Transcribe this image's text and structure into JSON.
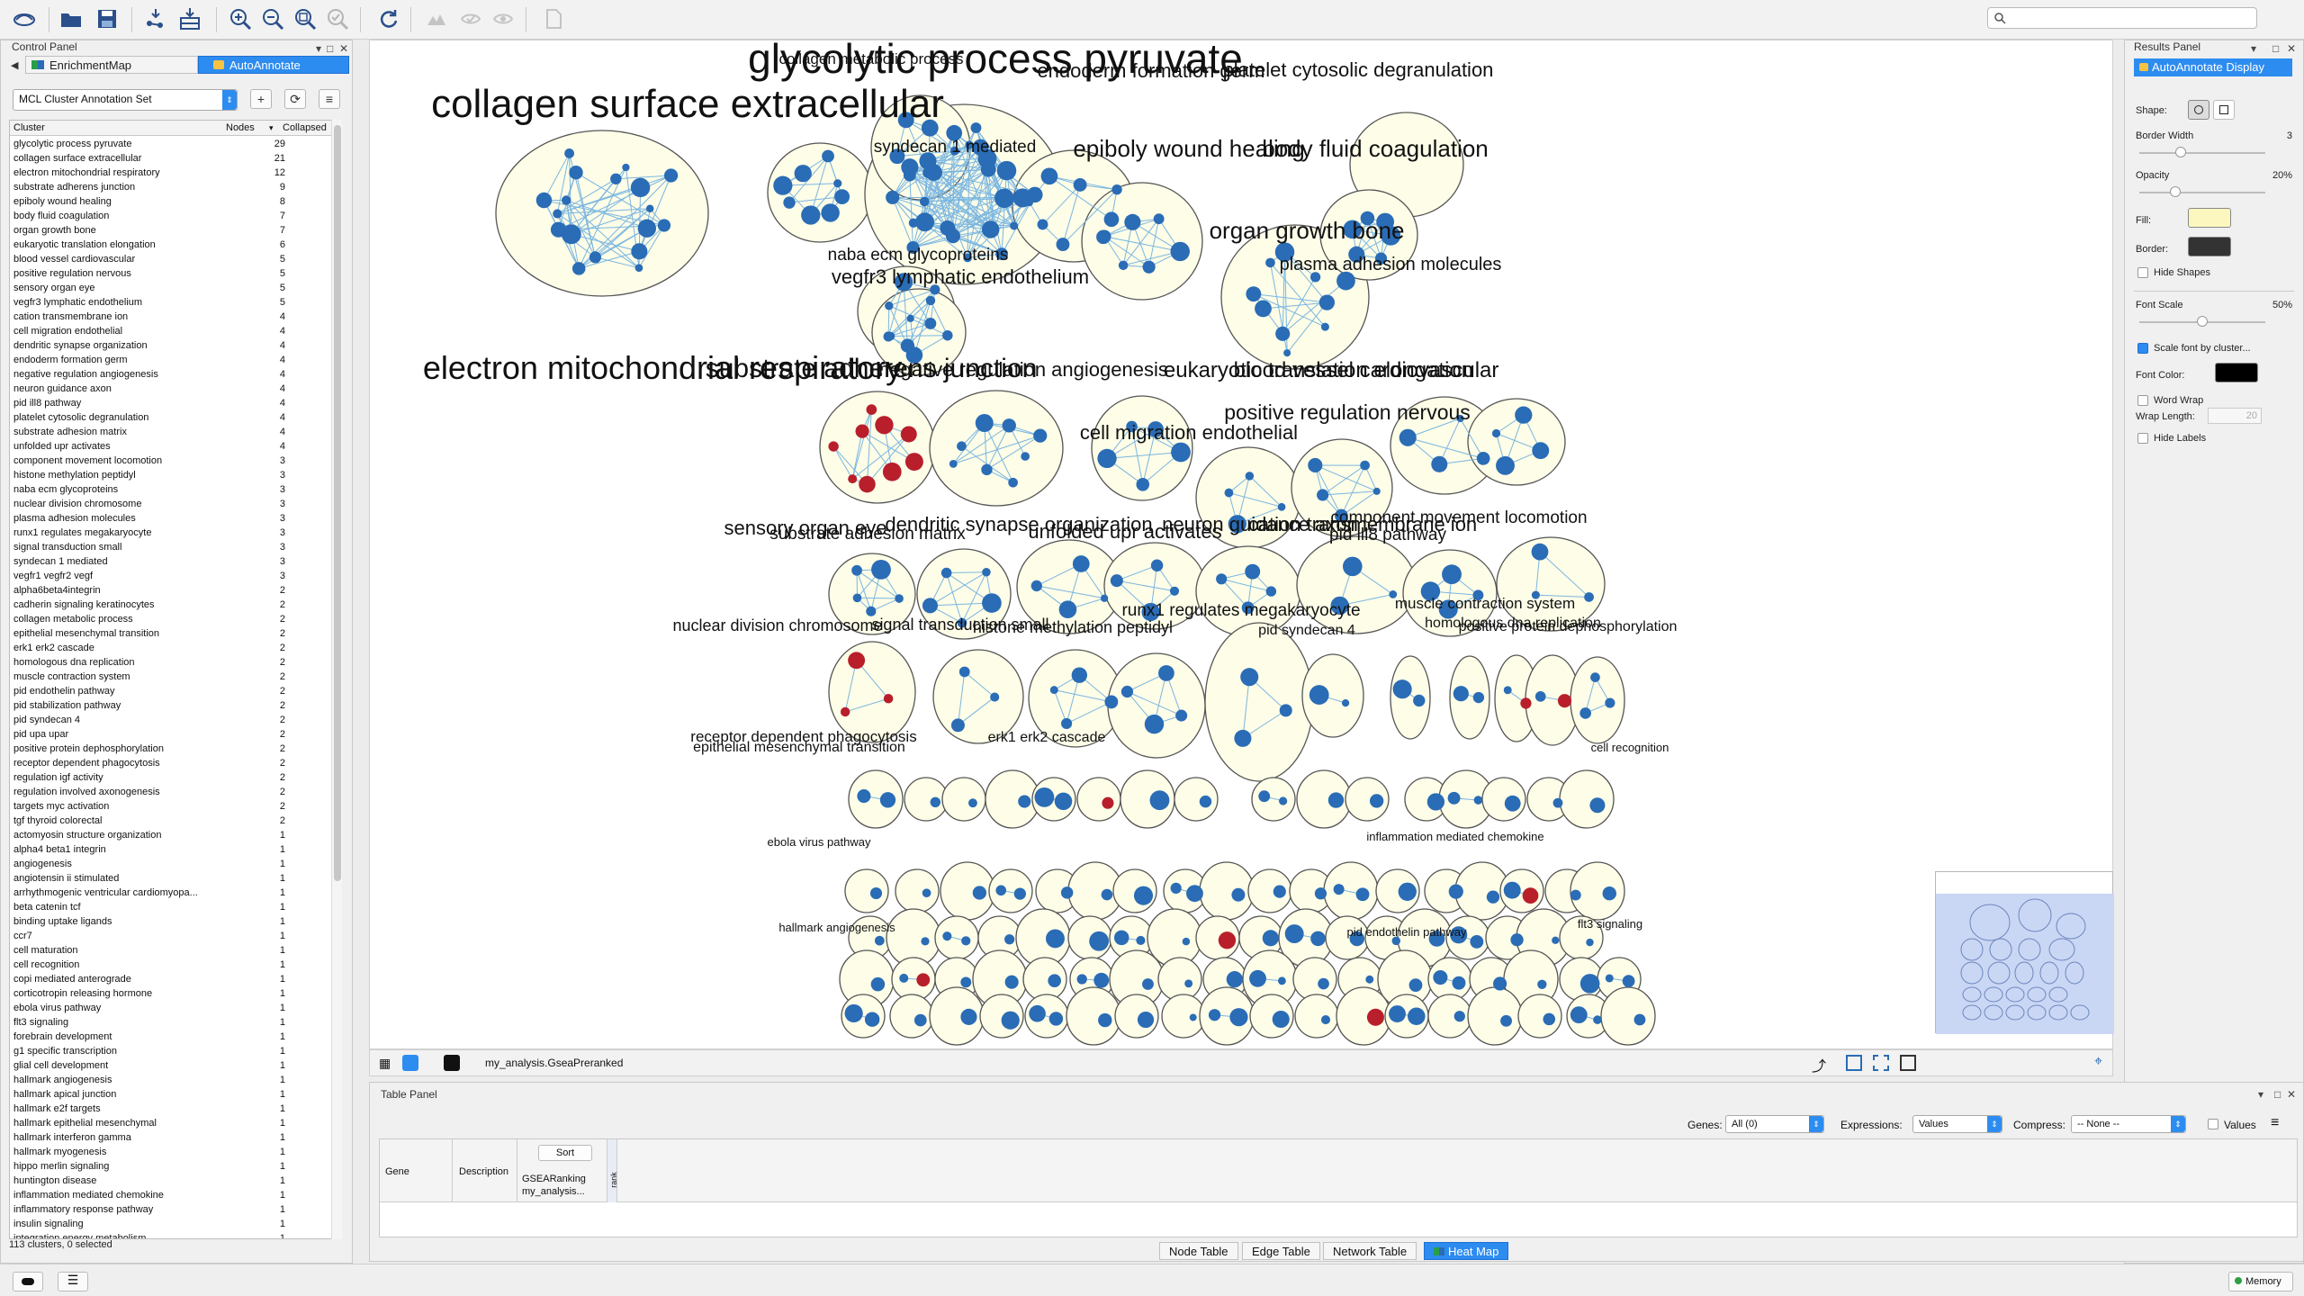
{
  "control_panel": {
    "title": "Control Panel",
    "tabs": [
      {
        "label": "EnrichmentMap"
      },
      {
        "label": "AutoAnnotate"
      }
    ],
    "annotation_set": "MCL Cluster Annotation Set",
    "columns": {
      "cluster": "Cluster",
      "nodes": "Nodes",
      "collapsed": "Collapsed"
    },
    "clusters": [
      {
        "name": "glycolytic process pyruvate",
        "nodes": "29"
      },
      {
        "name": "collagen surface extracellular",
        "nodes": "21"
      },
      {
        "name": "electron mitochondrial respiratory",
        "nodes": "12"
      },
      {
        "name": "substrate adherens junction",
        "nodes": "9"
      },
      {
        "name": "epiboly wound healing",
        "nodes": "8"
      },
      {
        "name": "body fluid coagulation",
        "nodes": "7"
      },
      {
        "name": "organ growth bone",
        "nodes": "7"
      },
      {
        "name": "eukaryotic translation elongation",
        "nodes": "6"
      },
      {
        "name": "blood vessel cardiovascular",
        "nodes": "5"
      },
      {
        "name": "positive regulation nervous",
        "nodes": "5"
      },
      {
        "name": "sensory organ eye",
        "nodes": "5"
      },
      {
        "name": "vegfr3 lymphatic endothelium",
        "nodes": "5"
      },
      {
        "name": "cation transmembrane ion",
        "nodes": "4"
      },
      {
        "name": "cell migration endothelial",
        "nodes": "4"
      },
      {
        "name": "dendritic synapse organization",
        "nodes": "4"
      },
      {
        "name": "endoderm formation germ",
        "nodes": "4"
      },
      {
        "name": "negative regulation angiogenesis",
        "nodes": "4"
      },
      {
        "name": "neuron guidance axon",
        "nodes": "4"
      },
      {
        "name": "pid ill8 pathway",
        "nodes": "4"
      },
      {
        "name": "platelet cytosolic degranulation",
        "nodes": "4"
      },
      {
        "name": "substrate adhesion matrix",
        "nodes": "4"
      },
      {
        "name": "unfolded upr activates",
        "nodes": "4"
      },
      {
        "name": "component movement locomotion",
        "nodes": "3"
      },
      {
        "name": "histone methylation peptidyl",
        "nodes": "3"
      },
      {
        "name": "naba ecm glycoproteins",
        "nodes": "3"
      },
      {
        "name": "nuclear division chromosome",
        "nodes": "3"
      },
      {
        "name": "plasma adhesion molecules",
        "nodes": "3"
      },
      {
        "name": "runx1 regulates megakaryocyte",
        "nodes": "3"
      },
      {
        "name": "signal transduction small",
        "nodes": "3"
      },
      {
        "name": "syndecan 1 mediated",
        "nodes": "3"
      },
      {
        "name": "vegfr1 vegfr2 vegf",
        "nodes": "3"
      },
      {
        "name": "alpha6beta4integrin",
        "nodes": "2"
      },
      {
        "name": "cadherin signaling keratinocytes",
        "nodes": "2"
      },
      {
        "name": "collagen metabolic process",
        "nodes": "2"
      },
      {
        "name": "epithelial mesenchymal transition",
        "nodes": "2"
      },
      {
        "name": "erk1 erk2 cascade",
        "nodes": "2"
      },
      {
        "name": "homologous dna replication",
        "nodes": "2"
      },
      {
        "name": "muscle contraction system",
        "nodes": "2"
      },
      {
        "name": "pid endothelin pathway",
        "nodes": "2"
      },
      {
        "name": "pid stabilization pathway",
        "nodes": "2"
      },
      {
        "name": "pid syndecan 4",
        "nodes": "2"
      },
      {
        "name": "pid upa upar",
        "nodes": "2"
      },
      {
        "name": "positive protein dephosphorylation",
        "nodes": "2"
      },
      {
        "name": "receptor dependent phagocytosis",
        "nodes": "2"
      },
      {
        "name": "regulation igf activity",
        "nodes": "2"
      },
      {
        "name": "regulation involved axonogenesis",
        "nodes": "2"
      },
      {
        "name": "targets myc activation",
        "nodes": "2"
      },
      {
        "name": "tgf thyroid colorectal",
        "nodes": "2"
      },
      {
        "name": "actomyosin structure organization",
        "nodes": "1"
      },
      {
        "name": "alpha4 beta1 integrin",
        "nodes": "1"
      },
      {
        "name": "angiogenesis",
        "nodes": "1"
      },
      {
        "name": "angiotensin ii stimulated",
        "nodes": "1"
      },
      {
        "name": "arrhythmogenic ventricular cardiomyopa...",
        "nodes": "1"
      },
      {
        "name": "beta catenin tcf",
        "nodes": "1"
      },
      {
        "name": "binding uptake ligands",
        "nodes": "1"
      },
      {
        "name": "ccr7",
        "nodes": "1"
      },
      {
        "name": "cell maturation",
        "nodes": "1"
      },
      {
        "name": "cell recognition",
        "nodes": "1"
      },
      {
        "name": "copi mediated anterograde",
        "nodes": "1"
      },
      {
        "name": "corticotropin releasing hormone",
        "nodes": "1"
      },
      {
        "name": "ebola virus pathway",
        "nodes": "1"
      },
      {
        "name": "flt3 signaling",
        "nodes": "1"
      },
      {
        "name": "forebrain development",
        "nodes": "1"
      },
      {
        "name": "g1 specific transcription",
        "nodes": "1"
      },
      {
        "name": "glial cell development",
        "nodes": "1"
      },
      {
        "name": "hallmark angiogenesis",
        "nodes": "1"
      },
      {
        "name": "hallmark apical junction",
        "nodes": "1"
      },
      {
        "name": "hallmark e2f targets",
        "nodes": "1"
      },
      {
        "name": "hallmark epithelial mesenchymal",
        "nodes": "1"
      },
      {
        "name": "hallmark interferon gamma",
        "nodes": "1"
      },
      {
        "name": "hallmark myogenesis",
        "nodes": "1"
      },
      {
        "name": "hippo merlin signaling",
        "nodes": "1"
      },
      {
        "name": "huntington disease",
        "nodes": "1"
      },
      {
        "name": "inflammation mediated chemokine",
        "nodes": "1"
      },
      {
        "name": "inflammatory response pathway",
        "nodes": "1"
      },
      {
        "name": "insulin signaling",
        "nodes": "1"
      },
      {
        "name": "integration energy metabolism",
        "nodes": "1"
      }
    ],
    "status": "113 clusters, 0 selected"
  },
  "network": {
    "title": "my_analysis.GseaPreranked",
    "labels": {
      "l1": "glycolytic process pyruvate",
      "l2": "collagen surface extracellular",
      "l3": "electron mitochondrial respiratory",
      "l4": "collagen metabolic process",
      "l5": "endoderm formation germ",
      "l6": "platelet cytosolic degranulation",
      "l7": "syndecan 1 mediated",
      "l8": "epiboly wound healing",
      "l9": "body fluid coagulation",
      "l10": "organ growth bone",
      "l11": "plasma adhesion molecules",
      "l12": "naba ecm glycoproteins",
      "l13": "vegfr3 lymphatic endothelium",
      "l14": "substrate adherens junction",
      "l15": "negative regulation angiogenesis",
      "l16": "eukaryotic translation elongation",
      "l17": "blood vessel cardiovascular",
      "l18": "positive regulation nervous",
      "l19": "cell migration endothelial",
      "l20": "sensory organ eye",
      "l21": "dendritic synapse organization",
      "l22": "substrate adhesion matrix",
      "l23": "unfolded upr activates",
      "l24": "neuron guidance axon",
      "l25": "cation transmembrane ion",
      "l26": "component movement locomotion",
      "l27": "pid ill8 pathway",
      "l28": "runx1 regulates megakaryocyte",
      "l29": "muscle contraction system",
      "l30": "nuclear division chromosome",
      "l31": "signal transduction small",
      "l32": "histone methylation peptidyl",
      "l33": "pid syndecan 4",
      "l34": "homologous dna replication",
      "l35": "positive protein dephosphorylation",
      "l36": "receptor dependent phagocytosis",
      "l37": "erk1 erk2 cascade",
      "l38": "epithelial mesenchymal transition",
      "l39": "ebola virus pathway",
      "l40": "inflammation mediated chemokine",
      "l41": "flt3 signaling",
      "l42": "hallmark angiogenesis",
      "l43": "pid endothelin pathway",
      "l44": "cell recognition"
    },
    "colors": {
      "node": "#2a6cb5",
      "red_node": "#b81f2b",
      "cluster_fill": "#fdfde8",
      "cluster_border": "#555555",
      "edge": "#7bb6e0"
    }
  },
  "results_panel": {
    "title": "Results Panel",
    "tab": "AutoAnnotate Display",
    "shape_label": "Shape:",
    "border_width_label": "Border Width",
    "border_width_value": "3",
    "opacity_label": "Opacity",
    "opacity_value": "20%",
    "fill_label": "Fill:",
    "fill_color": "#fcf7bf",
    "border_label": "Border:",
    "border_color": "#333333",
    "hide_shapes": "Hide Shapes",
    "font_scale_label": "Font Scale",
    "font_scale_value": "50%",
    "scale_font": "Scale font by cluster...",
    "font_color_label": "Font Color:",
    "font_color": "#000000",
    "word_wrap": "Word Wrap",
    "wrap_length_label": "Wrap Length:",
    "wrap_length_value": "20",
    "hide_labels": "Hide Labels"
  },
  "table_panel": {
    "title": "Table Panel",
    "genes_label": "Genes:",
    "genes_value": "All (0)",
    "expressions_label": "Expressions:",
    "expressions_value": "Values",
    "compress_label": "Compress:",
    "compress_value": "-- None --",
    "values_check": "Values",
    "col_gene": "Gene",
    "col_description": "Description",
    "sort_button": "Sort",
    "ranking_label": "GSEARanking",
    "ranking_sub": "my_analysis...",
    "rank_col": "rank",
    "tabs": [
      "Node Table",
      "Edge Table",
      "Network Table",
      "Heat Map"
    ]
  },
  "statusbar": {
    "memory": "Memory"
  }
}
